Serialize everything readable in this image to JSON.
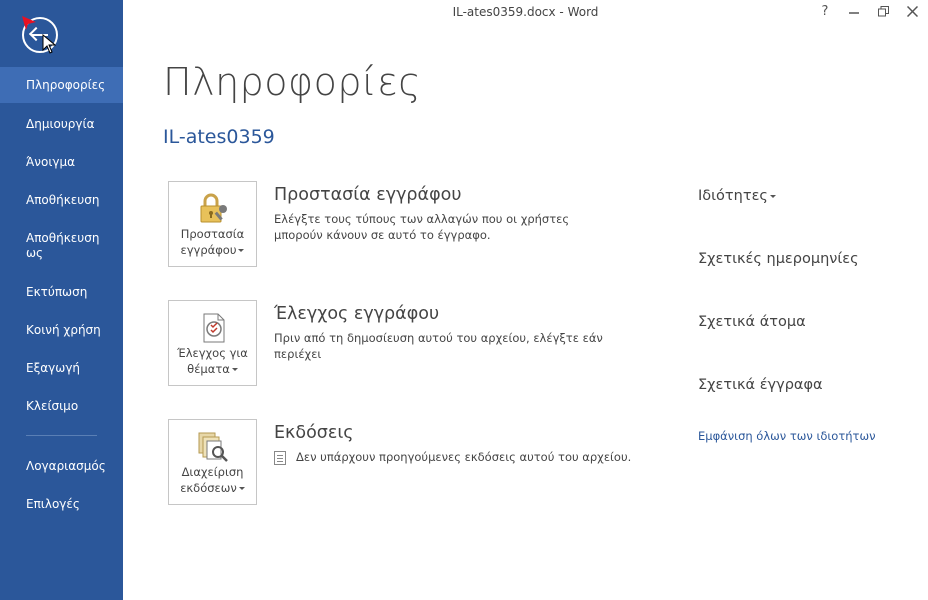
{
  "window": {
    "title": "IL-ates0359.docx - Word",
    "help": "?",
    "minimize": "—",
    "restore": "❐",
    "close": "✕"
  },
  "sidebar": {
    "items": [
      {
        "label": "Πληροφορίες",
        "active": true
      },
      {
        "label": "Δημιουργία"
      },
      {
        "label": "Άνοιγμα"
      },
      {
        "label": "Αποθήκευση"
      },
      {
        "label": "Αποθήκευση ως"
      },
      {
        "label": "Εκτύπωση"
      },
      {
        "label": "Κοινή χρήση"
      },
      {
        "label": "Εξαγωγή"
      },
      {
        "label": "Κλείσιμο"
      },
      {
        "label": "Λογαριασμός"
      },
      {
        "label": "Επιλογές"
      }
    ]
  },
  "main": {
    "page_title": "Πληροφορίες",
    "doc_name": "IL-ates0359",
    "sections": [
      {
        "button_line1": "Προστασία",
        "button_line2": "εγγράφου",
        "heading": "Προστασία εγγράφου",
        "description": "Ελέγξτε τους τύπους των αλλαγών που οι χρήστες μπορούν κάνουν σε αυτό το έγγραφο.",
        "icon": "lock-key-icon"
      },
      {
        "button_line1": "Έλεγχος για",
        "button_line2": "θέματα",
        "heading": "Έλεγχος εγγράφου",
        "description": "Πριν από τη δημοσίευση αυτού του αρχείου, ελέγξτε εάν περιέχει",
        "icon": "inspect-document-icon"
      },
      {
        "button_line1": "Διαχείριση",
        "button_line2": "εκδόσεων",
        "heading": "Εκδόσεις",
        "description": "Δεν υπάρχουν προηγούμενες εκδόσεις αυτού του αρχείου.",
        "icon": "manage-versions-icon"
      }
    ]
  },
  "properties": {
    "title": "Ιδιότητες",
    "related_dates": "Σχετικές ημερομηνίες",
    "related_people": "Σχετικά άτομα",
    "related_documents": "Σχετικά έγγραφα",
    "show_all": "Εμφάνιση όλων των ιδιοτήτων"
  },
  "colors": {
    "sidebar": "#2b579a",
    "sidebar_active": "#3e6db5",
    "accent": "#2b579a"
  }
}
